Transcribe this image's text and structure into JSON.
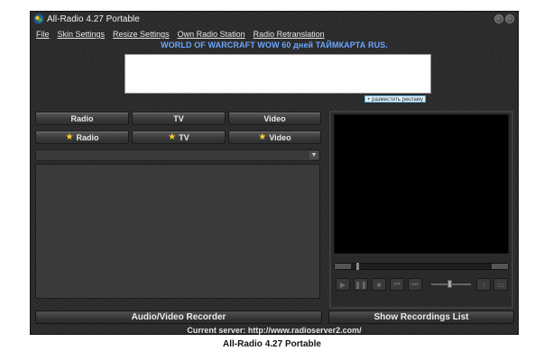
{
  "window": {
    "title": "All-Radio 4.27 Portable",
    "icon": "app-icon"
  },
  "menu": [
    {
      "label": "File"
    },
    {
      "label": "Skin Settings"
    },
    {
      "label": "Resize Settings"
    },
    {
      "label": "Own Radio Station"
    },
    {
      "label": "Radio Retranslation"
    }
  ],
  "banner": {
    "text": "WORLD OF WARCRAFT WOW 60 дней ТАЙМКАРТА RUS.",
    "ad_link": "+ разместить рекламу"
  },
  "tabs": {
    "radio": "Radio",
    "tv": "TV",
    "video": "Video",
    "fav_radio": "Radio",
    "fav_tv": "TV",
    "fav_video": "Video"
  },
  "buttons": {
    "recorder": "Audio/Video Recorder",
    "recordings": "Show Recordings List"
  },
  "status": {
    "text": "Current server: http://www.radioserver2.com/"
  },
  "caption": {
    "text": "All-Radio 4.27 Portable"
  },
  "colors": {
    "banner_text": "#6aa6ff",
    "star": "#ffce2e",
    "window_bg": "#2b2b2b"
  }
}
